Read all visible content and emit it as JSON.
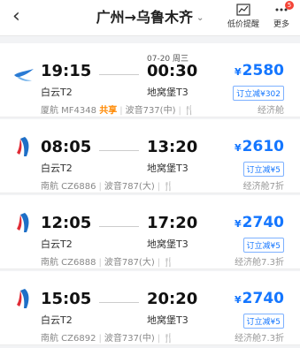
{
  "header": {
    "route_label": "广州→乌鲁木齐",
    "alert_label": "低价提醒",
    "more_label": "更多",
    "badge_count": "5"
  },
  "flights": [
    {
      "airline": "xiamen-airlines",
      "dep_time": "19:15",
      "arr_time": "00:30",
      "arr_date": "07-20 周三",
      "dep_airport": "白云T2",
      "arr_airport": "地窝堡T3",
      "flight_no": "厦航 MF4348",
      "share_label": "共享",
      "aircraft": "波音737(中)",
      "currency": "¥",
      "price": "2580",
      "discount": "订立减¥302",
      "cabin": "经济舱"
    },
    {
      "airline": "china-southern",
      "dep_time": "08:05",
      "arr_time": "13:20",
      "arr_date": "",
      "dep_airport": "白云T2",
      "arr_airport": "地窝堡T3",
      "flight_no": "南航 CZ6886",
      "share_label": "",
      "aircraft": "波音787(大)",
      "currency": "¥",
      "price": "2610",
      "discount": "订立减¥5",
      "cabin": "经济舱7折"
    },
    {
      "airline": "china-southern",
      "dep_time": "12:05",
      "arr_time": "17:20",
      "arr_date": "",
      "dep_airport": "白云T2",
      "arr_airport": "地窝堡T3",
      "flight_no": "南航 CZ6888",
      "share_label": "",
      "aircraft": "波音787(大)",
      "currency": "¥",
      "price": "2740",
      "discount": "订立减¥5",
      "cabin": "经济舱7.3折"
    },
    {
      "airline": "china-southern",
      "dep_time": "15:05",
      "arr_time": "20:20",
      "arr_date": "",
      "dep_airport": "白云T2",
      "arr_airport": "地窝堡T3",
      "flight_no": "南航 CZ6892",
      "share_label": "",
      "aircraft": "波音737(中)",
      "currency": "¥",
      "price": "2740",
      "discount": "订立减¥5",
      "cabin": "经济舱7.3折"
    }
  ]
}
